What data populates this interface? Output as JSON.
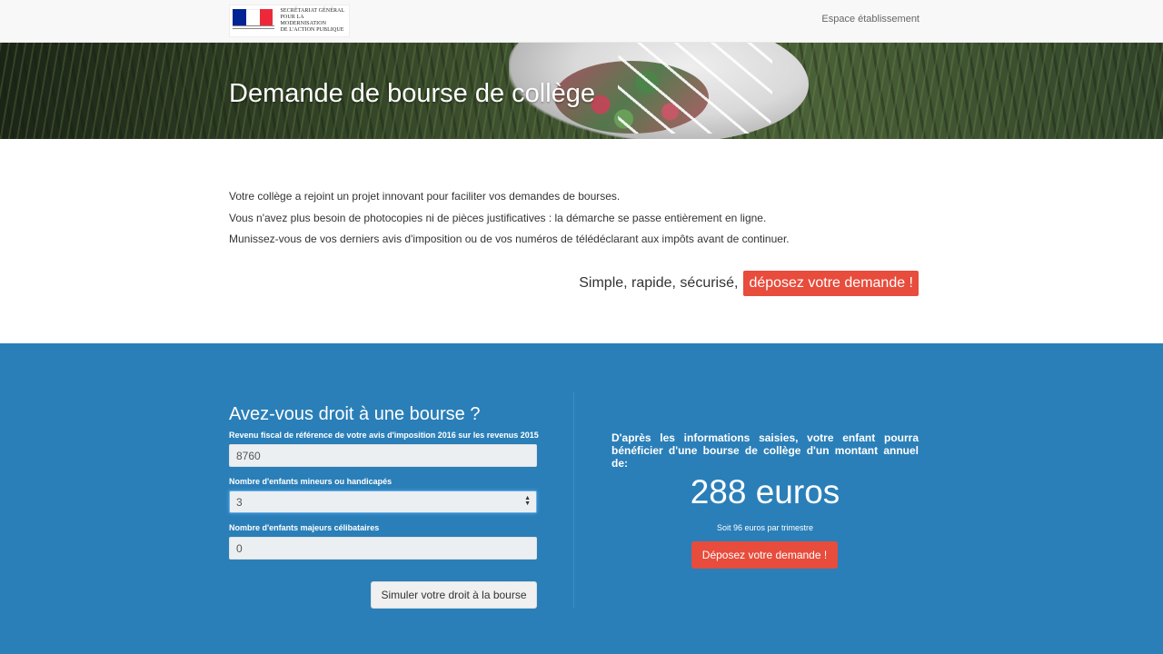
{
  "header": {
    "logo_text": "Secrétariat général\npour la modernisation\nde l'action publique",
    "nav_link": "Espace établissement"
  },
  "hero": {
    "title": "Demande de bourse de collège"
  },
  "intro": {
    "lines": [
      "Votre collège a rejoint un projet innovant pour faciliter vos demandes de bourses.",
      "Vous n'avez plus besoin de photocopies ni de pièces justificatives : la démarche se passe entièrement en ligne.",
      "Munissez-vous de vos derniers avis d'imposition ou de vos numéros de télédéclarant aux impôts avant de continuer."
    ],
    "cta_text": "Simple, rapide, sécurisé,",
    "cta_button": "déposez votre demande !"
  },
  "simulator": {
    "title": "Avez-vous droit à une bourse ?",
    "fields": [
      {
        "label": "Revenu fiscal de référence de votre avis d'imposition 2016 sur les revenus 2015",
        "value": "8760"
      },
      {
        "label": "Nombre d'enfants mineurs ou handicapés",
        "value": "3"
      },
      {
        "label": "Nombre d'enfants majeurs célibataires",
        "value": "0"
      }
    ],
    "submit": "Simuler votre droit à la bourse"
  },
  "result": {
    "text": "D'après les informations saisies, votre enfant pourra bénéficier d'une bourse de collège d'un montant annuel de:",
    "amount": "288 euros",
    "per_term": "Soit 96 euros par trimestre",
    "button": "Déposez votre demande !"
  },
  "colors": {
    "accent_red": "#e74c3c",
    "section_blue": "#2a7fb8",
    "flag": [
      "#002395",
      "#ffffff",
      "#ed2939"
    ]
  }
}
